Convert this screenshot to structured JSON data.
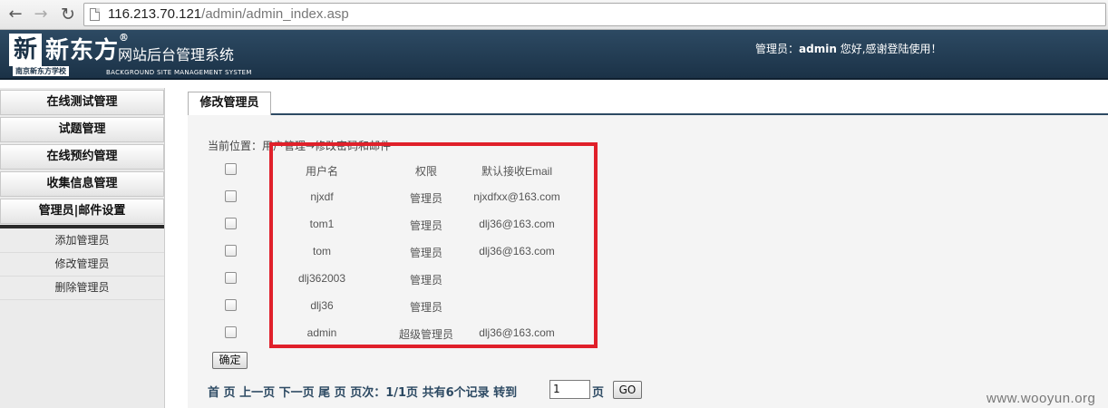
{
  "browser": {
    "url_host": "116.213.70.121",
    "url_path": "/admin/admin_index.asp"
  },
  "header": {
    "brand": "新东方",
    "brand_mark": "新",
    "brand_reg": "®",
    "brand_sub": "南京新东方学校",
    "site_title": "网站后台管理系统",
    "site_sub": "BACKGROUND SITE MANAGEMENT SYSTEM",
    "welcome_prefix": "管理员：",
    "welcome_user": "admin",
    "welcome_suffix": " 您好,感谢登陆使用！"
  },
  "sidebar": {
    "menu": [
      {
        "label": "在线测试管理"
      },
      {
        "label": "试题管理"
      },
      {
        "label": "在线预约管理"
      },
      {
        "label": "收集信息管理"
      },
      {
        "label": "管理员|邮件设置"
      }
    ],
    "submenu": [
      {
        "label": "添加管理员"
      },
      {
        "label": "修改管理员"
      },
      {
        "label": "删除管理员"
      }
    ]
  },
  "main": {
    "tab_label": "修改管理员",
    "breadcrumb": "当前位置：用户管理→修改密码和邮件",
    "table": {
      "headers": {
        "username": "用户名",
        "role": "权限",
        "email": "默认接收Email"
      },
      "rows": [
        {
          "username": "njxdf",
          "role": "管理员",
          "email": "njxdfxx@163.com"
        },
        {
          "username": "tom1",
          "role": "管理员",
          "email": "dlj36@163.com"
        },
        {
          "username": "tom",
          "role": "管理员",
          "email": "dlj36@163.com"
        },
        {
          "username": "dlj362003",
          "role": "管理员",
          "email": ""
        },
        {
          "username": "dlj36",
          "role": "管理员",
          "email": ""
        },
        {
          "username": "admin",
          "role": "超级管理员",
          "email": "dlj36@163.com"
        }
      ]
    },
    "confirm_label": "确定",
    "pager": {
      "first": "首 页",
      "prev": "上一页",
      "next": "下一页",
      "last": "尾 页",
      "page_info": "页次：1/1页 共有6个记录 转到",
      "goto_value": "1",
      "page_unit": "页",
      "go_label": "GO"
    }
  },
  "watermark": "www.wooyun.org",
  "colors": {
    "header_bg": "#1b3247",
    "highlight": "#e0202a",
    "pager_text": "#2d4a63"
  }
}
